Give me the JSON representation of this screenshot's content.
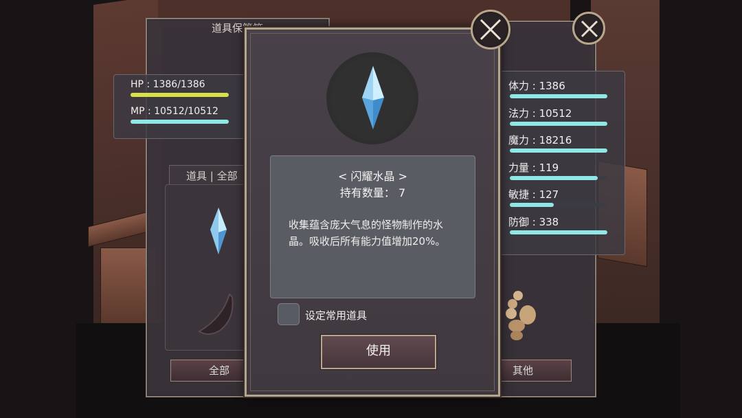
{
  "left_panel": {
    "title": "道具保管箱",
    "hp_label": "HP : 1386/1386",
    "mp_label": "MP : 10512/10512",
    "hp_fill": 1.0,
    "mp_fill": 1.0,
    "filter_label": "道具 | 全部",
    "bottom_tab": "全部"
  },
  "right_panel": {
    "stats": [
      {
        "label": "体力 : 1386",
        "fill": 1.0
      },
      {
        "label": "法力 : 10512",
        "fill": 1.0
      },
      {
        "label": "魔力 : 18216",
        "fill": 1.0
      },
      {
        "label": "力量 : 119",
        "fill": 0.9
      },
      {
        "label": "敏捷 : 127",
        "fill": 0.45
      },
      {
        "label": "防御 : 338",
        "fill": 1.0
      }
    ],
    "bottom_tab": "其他"
  },
  "dialog": {
    "item_name": "< 闪耀水晶 >",
    "quantity": "持有数量： 7",
    "description": "收集蕴含庞大气息的怪物制作的水晶。吸收后所有能力值增加20%。",
    "favorite_label": "设定常用道具",
    "use_button": "使用"
  },
  "colors": {
    "hp_bar": "#d8e04a",
    "mp_bar": "#8fe8e6",
    "frame_gold": "#b3a58e"
  },
  "icons": [
    "close-icon",
    "crystal-icon",
    "horn-icon",
    "scorpion-icon"
  ]
}
